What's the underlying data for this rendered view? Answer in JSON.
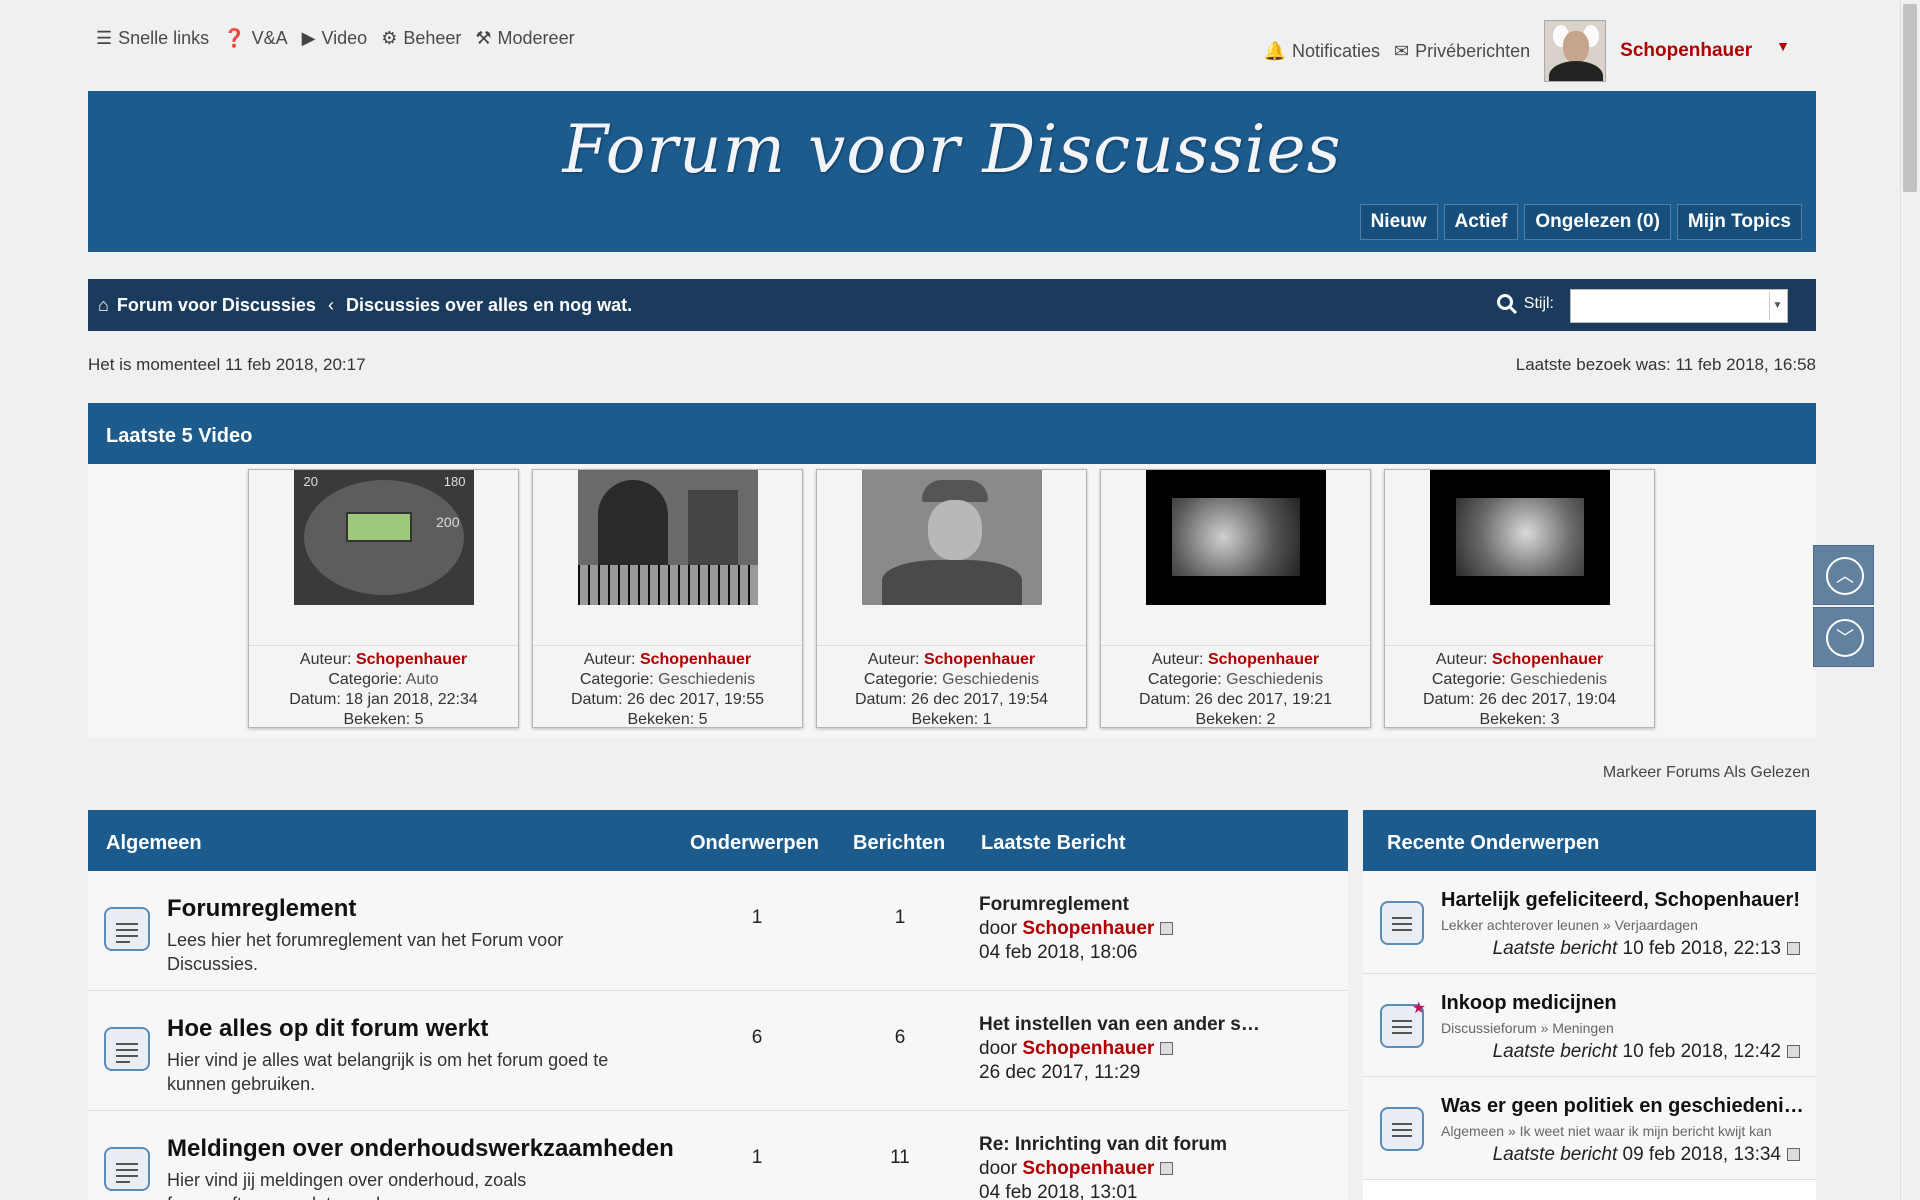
{
  "topnav": {
    "quicklinks": "Snelle links",
    "faq": "V&A",
    "video": "Video",
    "admin": "Beheer",
    "moderate": "Modereer",
    "notifications": "Notificaties",
    "pm": "Privéberichten",
    "username": "Schopenhauer"
  },
  "header": {
    "logo": "Forum voor Discussies",
    "buttons": [
      "Nieuw",
      "Actief",
      "Ongelezen (0)",
      "Mijn Topics"
    ]
  },
  "breadcrumb": {
    "home": "Forum voor Discussies",
    "separator": "‹",
    "current": "Discussies over alles en nog wat."
  },
  "style_label": "Stijl:",
  "info": {
    "now": "Het is momenteel 11 feb 2018, 20:17",
    "last_visit": "Laatste bezoek was: 11 feb 2018, 16:58"
  },
  "videos": {
    "title": "Laatste 5 Video",
    "author_label": "Auteur:",
    "category_label": "Categorie:",
    "date_label": "Datum:",
    "views_label": "Bekeken:",
    "items": [
      {
        "author": "Schopenhauer",
        "category": "Auto",
        "date": "18 jan 2018, 22:34",
        "views": "5"
      },
      {
        "author": "Schopenhauer",
        "category": "Geschiedenis",
        "date": "26 dec 2017, 19:55",
        "views": "5"
      },
      {
        "author": "Schopenhauer",
        "category": "Geschiedenis",
        "date": "26 dec 2017, 19:54",
        "views": "1"
      },
      {
        "author": "Schopenhauer",
        "category": "Geschiedenis",
        "date": "26 dec 2017, 19:21",
        "views": "2"
      },
      {
        "author": "Schopenhauer",
        "category": "Geschiedenis",
        "date": "26 dec 2017, 19:04",
        "views": "3"
      }
    ]
  },
  "mark_read": "Markeer Forums Als Gelezen",
  "forums": {
    "headers": {
      "name": "Algemeen",
      "topics": "Onderwerpen",
      "posts": "Berichten",
      "last": "Laatste Bericht"
    },
    "by": "door",
    "rows": [
      {
        "title": "Forumreglement",
        "desc": "Lees hier het forumreglement van het Forum voor Discussies.",
        "topics": "1",
        "posts": "1",
        "last_title": "Forumreglement",
        "last_author": "Schopenhauer",
        "last_date": "04 feb 2018, 18:06"
      },
      {
        "title": "Hoe alles op dit forum werkt",
        "desc": "Hier vind je alles wat belangrijk is om het forum goed te kunnen gebruiken.",
        "topics": "6",
        "posts": "6",
        "last_title": "Het instellen van een ander s…",
        "last_author": "Schopenhauer",
        "last_date": "26 dec 2017, 11:29"
      },
      {
        "title": "Meldingen over onderhoudswerkzaamheden",
        "desc": "Hier vind jij meldingen over onderhoud, zoals forumsoftware updates e.d.",
        "topics": "1",
        "posts": "11",
        "last_title": "Re: Inrichting van dit forum",
        "last_author": "Schopenhauer",
        "last_date": "04 feb 2018, 13:01"
      }
    ]
  },
  "recent": {
    "title": "Recente Onderwerpen",
    "last_label": "Laatste bericht",
    "sep": "»",
    "items": [
      {
        "title": "Hartelijk gefeliciteerd, Schopenhauer!",
        "forum": "Lekker achterover leunen",
        "sub": "Verjaardagen",
        "date": "10 feb 2018, 22:13"
      },
      {
        "title": "Inkoop medicijnen",
        "forum": "Discussieforum",
        "sub": "Meningen",
        "date": "10 feb 2018, 12:42"
      },
      {
        "title": "Was er geen politiek en geschiedeni…",
        "forum": "Algemeen",
        "sub": "Ik weet niet waar ik mijn bericht kwijt kan",
        "date": "09 feb 2018, 13:34"
      }
    ]
  },
  "colors": {
    "primary": "#1d5b8c",
    "crumb": "#1a3b5c",
    "accent_red": "#b00000"
  }
}
